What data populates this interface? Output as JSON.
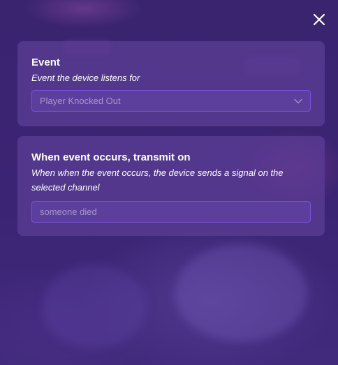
{
  "dialog": {
    "close_icon": "close-icon",
    "event_section": {
      "title": "Event",
      "description": "Event the device listens for",
      "selected": "Player Knocked Out",
      "dropdown_icon": "chevron-down-icon"
    },
    "transmit_section": {
      "title": "When event occurs, transmit on",
      "description": "When when the event occurs, the device sends a signal on the selected channel",
      "channel_value": "someone died"
    }
  },
  "colors": {
    "background": "#3a2270",
    "panel": "#5c3e96",
    "field_border": "#7a4fe0",
    "field_text": "#a896cc",
    "text": "#ffffff"
  }
}
